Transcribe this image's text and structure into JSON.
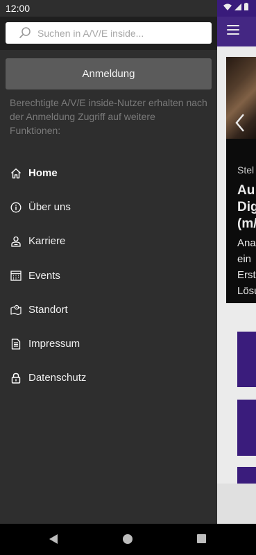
{
  "status_bar": {
    "time": "12:00"
  },
  "search": {
    "placeholder": "Suchen in A/V/E inside..."
  },
  "login": {
    "button_label": "Anmeldung",
    "hint": "Berechtigte A/V/E inside-Nutzer erhalten nach der Anmeldung Zugriff auf weitere Funktionen:"
  },
  "nav": {
    "items": [
      {
        "label": "Home",
        "icon": "home-icon",
        "active": true
      },
      {
        "label": "Über uns",
        "icon": "info-icon"
      },
      {
        "label": "Karriere",
        "icon": "person-icon"
      },
      {
        "label": "Events",
        "icon": "calendar-icon"
      },
      {
        "label": "Standort",
        "icon": "map-pin-icon"
      },
      {
        "label": "Impressum",
        "icon": "document-icon"
      },
      {
        "label": "Datenschutz",
        "icon": "lock-icon"
      }
    ]
  },
  "background": {
    "hero_kicker": "Stel",
    "hero_title_lines": [
      "Au",
      "Dig",
      "(m/"
    ],
    "hero_body_lines": [
      "Ana",
      "ein",
      "Erst",
      "Lösu"
    ]
  },
  "colors": {
    "drawer_bg": "#2e2e2e",
    "search_bar_bg": "#1f1f1f",
    "login_button_bg": "#5b5b5b",
    "brand_purple": "#3f1f87"
  }
}
